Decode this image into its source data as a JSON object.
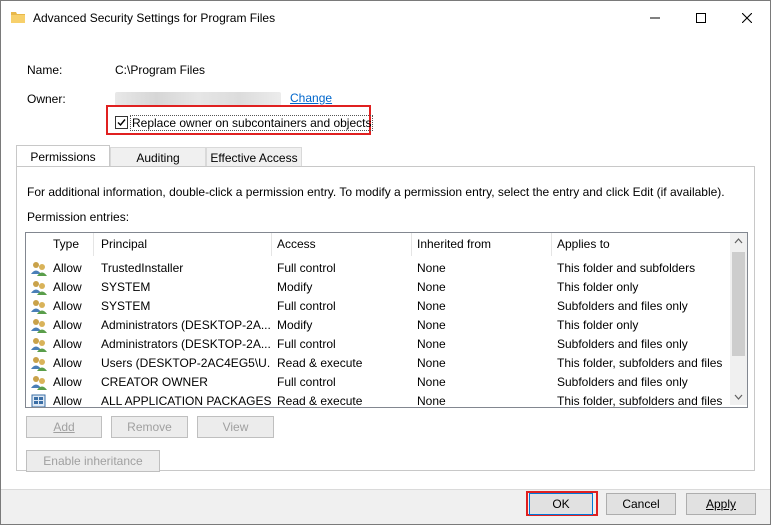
{
  "window": {
    "title": "Advanced Security Settings for Program Files"
  },
  "info": {
    "name_label": "Name:",
    "name_value": "C:\\Program Files",
    "owner_label": "Owner:",
    "change_link": "Change",
    "replace_owner_label": "Replace owner on subcontainers and objects",
    "replace_owner_checked": true
  },
  "tabs": [
    {
      "label": "Permissions",
      "active": true
    },
    {
      "label": "Auditing",
      "active": false
    },
    {
      "label": "Effective Access",
      "active": false
    }
  ],
  "permissions": {
    "info_text": "For additional information, double-click a permission entry. To modify a permission entry, select the entry and click Edit (if available).",
    "entries_label": "Permission entries:",
    "columns": [
      "Type",
      "Principal",
      "Access",
      "Inherited from",
      "Applies to"
    ],
    "rows": [
      {
        "type": "Allow",
        "principal": "TrustedInstaller",
        "access": "Full control",
        "inherited": "None",
        "applies": "This folder and subfolders"
      },
      {
        "type": "Allow",
        "principal": "SYSTEM",
        "access": "Modify",
        "inherited": "None",
        "applies": "This folder only"
      },
      {
        "type": "Allow",
        "principal": "SYSTEM",
        "access": "Full control",
        "inherited": "None",
        "applies": "Subfolders and files only"
      },
      {
        "type": "Allow",
        "principal": "Administrators (DESKTOP-2A...",
        "access": "Modify",
        "inherited": "None",
        "applies": "This folder only"
      },
      {
        "type": "Allow",
        "principal": "Administrators (DESKTOP-2A...",
        "access": "Full control",
        "inherited": "None",
        "applies": "Subfolders and files only"
      },
      {
        "type": "Allow",
        "principal": "Users (DESKTOP-2AC4EG5\\U...",
        "access": "Read & execute",
        "inherited": "None",
        "applies": "This folder, subfolders and files"
      },
      {
        "type": "Allow",
        "principal": "CREATOR OWNER",
        "access": "Full control",
        "inherited": "None",
        "applies": "Subfolders and files only"
      },
      {
        "type": "Allow",
        "principal": "ALL APPLICATION PACKAGES",
        "access": "Read & execute",
        "inherited": "None",
        "applies": "This folder, subfolders and files"
      }
    ]
  },
  "buttons": {
    "add": "Add",
    "remove": "Remove",
    "view": "View",
    "enable_inheritance": "Enable inheritance",
    "ok": "OK",
    "cancel": "Cancel",
    "apply": "Apply"
  },
  "colors": {
    "highlight": "#e02020",
    "link": "#0066cc",
    "disabled_text": "#a0a0a0"
  }
}
